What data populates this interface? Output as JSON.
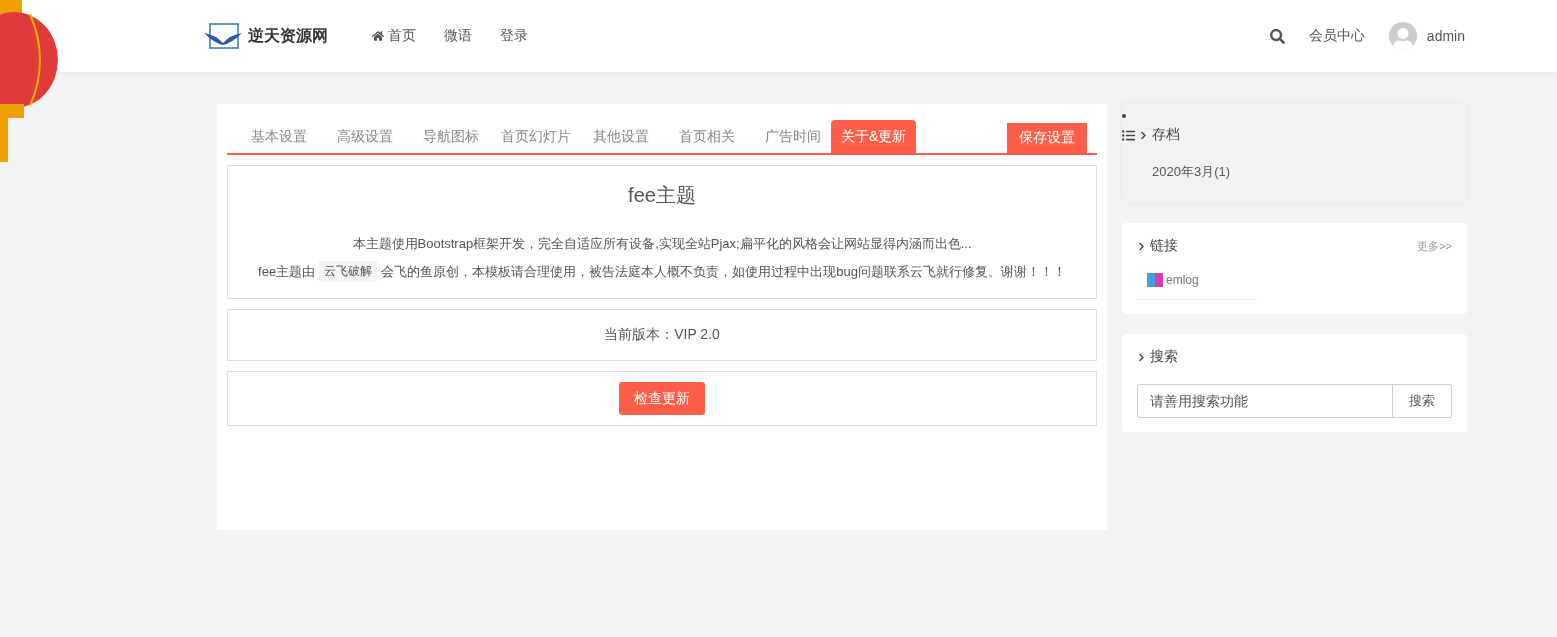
{
  "header": {
    "logo_text": "逆天资源网",
    "nav": [
      {
        "label": "首页",
        "kind": "iconed",
        "selected": false
      },
      {
        "label": "微语",
        "kind": "plain",
        "selected": false
      },
      {
        "label": "登录",
        "kind": "plain",
        "selected": false
      }
    ],
    "member_center": "会员中心",
    "user": "admin"
  },
  "settings": {
    "tabs": [
      {
        "label": "基本设置",
        "selected": false
      },
      {
        "label": "高级设置",
        "selected": false
      },
      {
        "label": "导航图标",
        "selected": false
      },
      {
        "label": "首页幻灯片",
        "selected": false
      },
      {
        "label": "其他设置",
        "selected": false
      },
      {
        "label": "首页相关",
        "selected": false
      },
      {
        "label": "广告时间",
        "selected": false
      },
      {
        "label": "关于&更新",
        "selected": true
      }
    ],
    "save_button": "保存设置",
    "about": {
      "title": "fee主题",
      "description": "本主题使用Bootstrap框架开发，完全自适应所有设备,实现全站Pjax;扁平化的风格会让网站显得内涵而出色...",
      "credit_prefix": "fee主题由",
      "credit_tag": "云飞破解",
      "credit_suffix": "会飞的鱼原创，本模板请合理使用，被告法庭本人概不负责，如使用过程中出现bug问题联系云飞就行修复。谢谢！！！"
    },
    "version": "当前版本：VIP 2.0",
    "check_button": "检查更新"
  },
  "sidebar": {
    "archive": {
      "title": "存档",
      "items": [
        "2020年3月(1)"
      ]
    },
    "links": {
      "title": "链接",
      "more": "更多>>",
      "items": [
        "emlog"
      ]
    },
    "search": {
      "title": "搜索",
      "placeholder": "请善用搜索功能",
      "button": "搜索"
    }
  }
}
